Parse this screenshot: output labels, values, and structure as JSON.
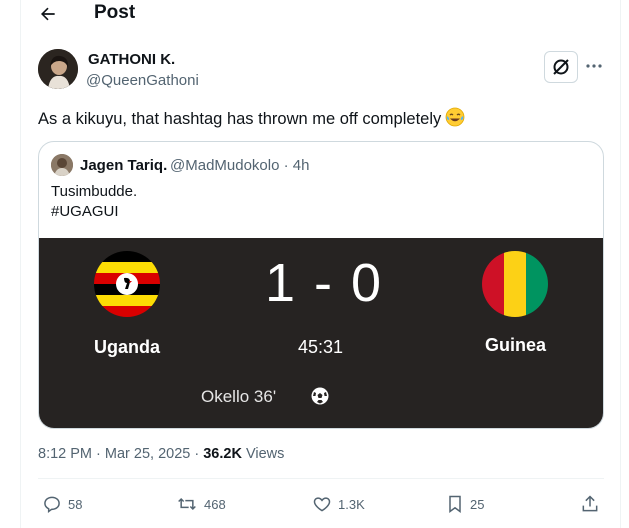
{
  "header": {
    "title": "Post",
    "back_icon": "arrow-left-icon"
  },
  "post": {
    "author_name": "GATHONI K.",
    "author_handle": "@QueenGathoni",
    "text": "As a kikuyu, that hashtag has thrown me off completely",
    "emoji": "face-with-tears-of-joy-icon",
    "timestamp": "8:12 PM · Mar 25, 2025 · ",
    "views_count": "36.2K",
    "views_label": " Views"
  },
  "quoted_post": {
    "author_name": "Jagen Tariq.",
    "meta": "@MadMudokolo · 4h",
    "line1": "Tusimbudde.",
    "line2": "#UGAGUI"
  },
  "match": {
    "score": "1 - 0",
    "home_team": "Uganda",
    "away_team": "Guinea",
    "time": "45:31",
    "scorer": "Okello 36'"
  },
  "actions": {
    "replies": "58",
    "reposts": "468",
    "likes": "1.3K",
    "bookmarks": "25"
  },
  "colors": {
    "scorecard_bg": "#262322",
    "secondary_text": "#536471",
    "border": "#cfd9de"
  }
}
